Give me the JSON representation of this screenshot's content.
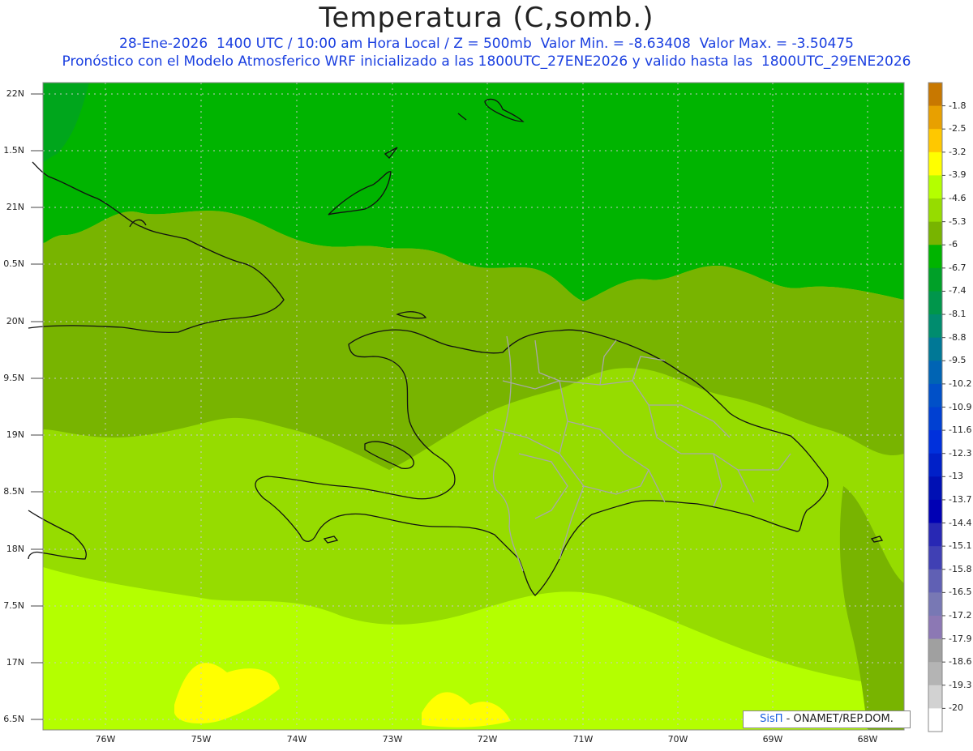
{
  "header": {
    "title": "Temperatura (C,somb.)",
    "line1": "28-Ene-2026  1400 UTC / 10:00 am Hora Local / Z = 500mb  Valor Min. = -8.63408  Valor Max. = -3.50475",
    "line2": "Pronóstico con el Modelo Atmosferico WRF inicializado a las 1800UTC_27ENE2026 y valido hasta las  1800UTC_29ENE2026"
  },
  "axes": {
    "lat_labels": [
      "22N",
      "1.5N",
      "21N",
      "0.5N",
      "20N",
      "9.5N",
      "19N",
      "8.5N",
      "18N",
      "7.5N",
      "17N",
      "6.5N"
    ],
    "lon_labels": [
      "76W",
      "75W",
      "74W",
      "73W",
      "72W",
      "71W",
      "70W",
      "69W",
      "68W"
    ]
  },
  "colorbar": {
    "labels": [
      "-1.8",
      "-2.5",
      "-3.2",
      "-3.9",
      "-4.6",
      "-5.3",
      "-6",
      "-6.7",
      "-7.4",
      "-8.1",
      "-8.8",
      "-9.5",
      "-10.2",
      "-10.9",
      "-11.6",
      "-12.3",
      "-13",
      "-13.7",
      "-14.4",
      "-15.1",
      "-15.8",
      "-16.5",
      "-17.2",
      "-17.9",
      "-18.6",
      "-19.3",
      "-20"
    ],
    "colors": [
      "#c87800",
      "#e8a000",
      "#ffc800",
      "#ffff00",
      "#b4ff00",
      "#96dc00",
      "#78b400",
      "#00b400",
      "#00a028",
      "#00964b",
      "#008c6e",
      "#007896",
      "#0064b4",
      "#0050c8",
      "#0040d2",
      "#0030dc",
      "#0020c8",
      "#0010b4",
      "#0000b4",
      "#2828b4",
      "#4040b4",
      "#6060b4",
      "#7878b4",
      "#8c78b4",
      "#a0a0a0",
      "#b4b4b4",
      "#d2d2d2",
      "#ffffff"
    ]
  },
  "credit": {
    "logo": "SisΠ",
    "text": " - ONAMET/REP.DOM."
  }
}
